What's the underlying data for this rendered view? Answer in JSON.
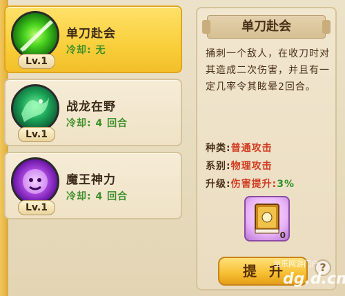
{
  "skills": [
    {
      "name": "单刀赴会",
      "cooldown": "冷却: 无",
      "level": "Lv.1",
      "icon": "green-slash-icon",
      "selected": true
    },
    {
      "name": "战龙在野",
      "cooldown": "冷却: 4 回合",
      "level": "Lv.1",
      "icon": "green-dragon-icon",
      "selected": false
    },
    {
      "name": "魔王神力",
      "cooldown": "冷却: 4 回合",
      "level": "Lv.1",
      "icon": "purple-lion-icon",
      "selected": false
    }
  ],
  "detail": {
    "title": "单刀赴会",
    "description": "捅刺一个敌人，在收刀时对其造成二次伤害，并且有一定几率令其眩晕2回合。",
    "type_label": "种类:",
    "type_value": "普通攻击",
    "series_label": "系别:",
    "series_value": "物理攻击",
    "upgrade_label": "升级:",
    "upgrade_value_red": "伤害提升:",
    "upgrade_value_green": "3%",
    "book_count": "0",
    "upgrade_button": "提升",
    "help_button": "?"
  },
  "watermark": {
    "line1": "当乐网游门户",
    "line2": "dg.d.cn"
  },
  "colors": {
    "selected_card": "#f9cf3b",
    "cooldown_text": "#3d8f2a",
    "stat_red": "#d13b1f",
    "stat_green": "#2f8f22"
  }
}
